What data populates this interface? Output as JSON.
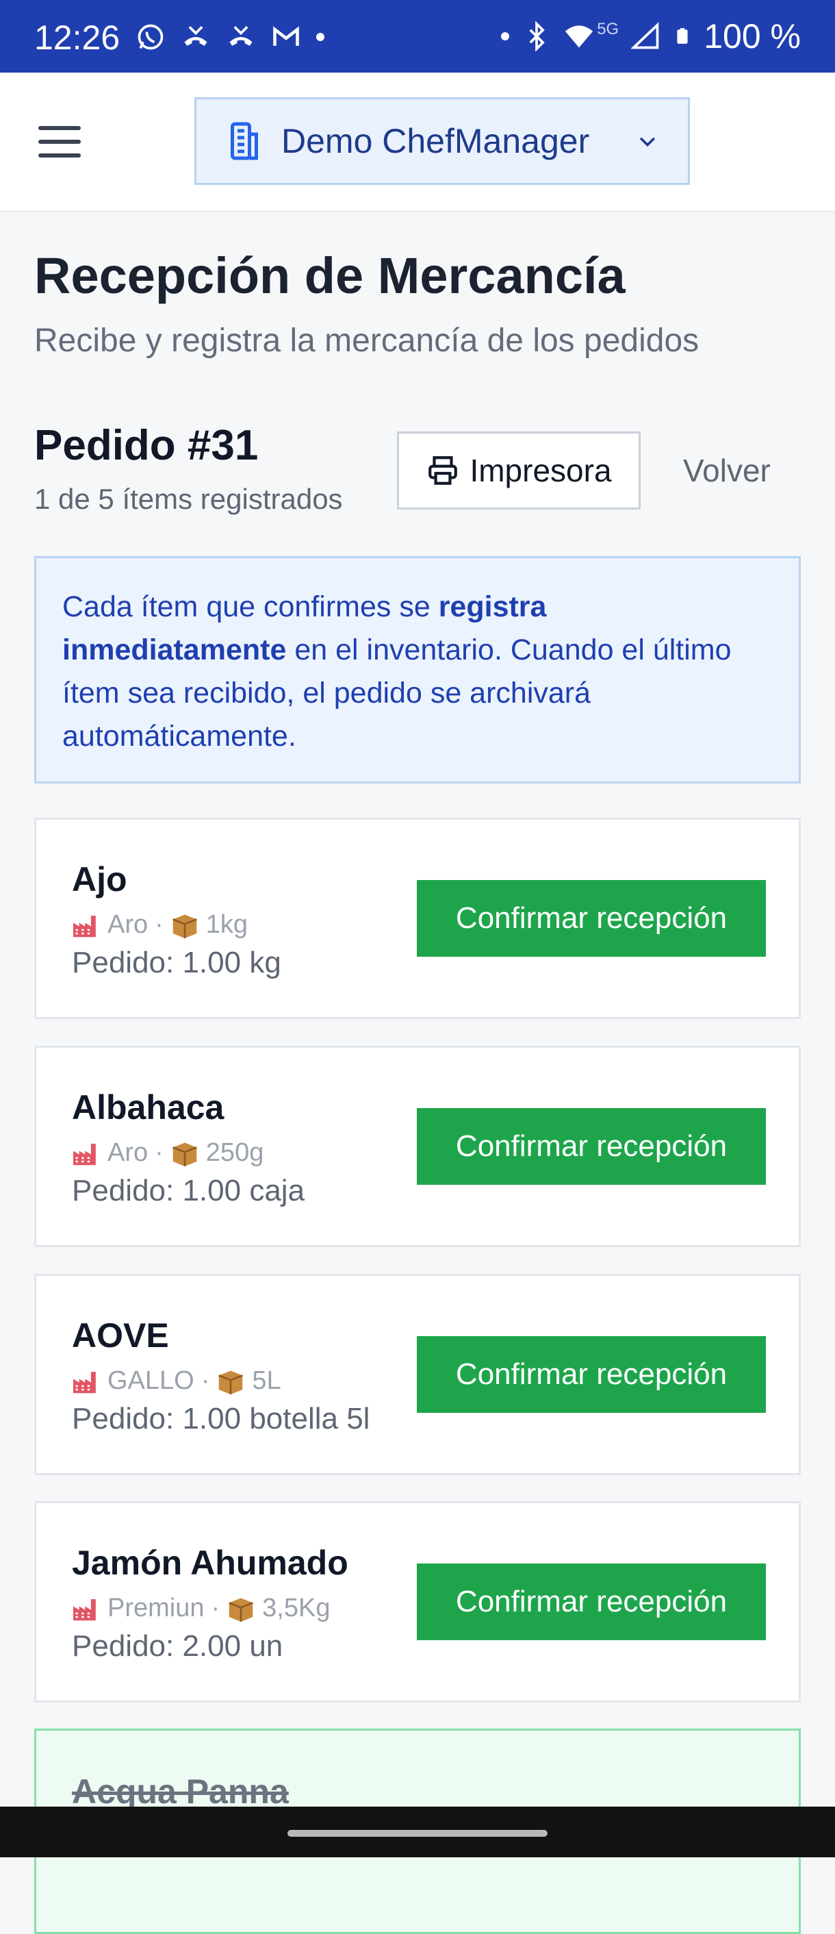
{
  "status_bar": {
    "time": "12:26",
    "battery": "100 %",
    "network": "5G",
    "icons_left": [
      "whatsapp-icon",
      "missed-call-icon",
      "missed-call-icon",
      "gmail-icon",
      "notification-dot"
    ],
    "icons_right": [
      "dot",
      "bluetooth-icon",
      "wifi-icon",
      "signal-icon",
      "battery-icon"
    ]
  },
  "header": {
    "menu_icon": "hamburger-icon",
    "org_name": "Demo ChefManager",
    "org_icon": "building-icon"
  },
  "page": {
    "title": "Recepción de Mercancía",
    "subtitle": "Recibe y registra la mercancía de los pedidos"
  },
  "order": {
    "id_label": "Pedido #31",
    "count_label": "1 de 5 ítems registrados",
    "printer_label": "Impresora",
    "back_label": "Volver"
  },
  "info": {
    "part1": "Cada ítem que confirmes se ",
    "bold": "registra inmediatamente",
    "part2": " en el inventario. Cuando el último ítem sea recibido, el pedido se archivará automáticamente."
  },
  "items": [
    {
      "name": "Ajo",
      "supplier": "Aro",
      "pack": "1kg",
      "ordered": "Pedido: 1.00 kg",
      "action": "Confirmar recepción"
    },
    {
      "name": "Albahaca",
      "supplier": "Aro",
      "pack": "250g",
      "ordered": "Pedido: 1.00 caja",
      "action": "Confirmar recepción"
    },
    {
      "name": "AOVE",
      "supplier": "GALLO",
      "pack": "5L",
      "ordered": "Pedido: 1.00 botella 5l",
      "action": "Confirmar recepción"
    },
    {
      "name": "Jamón Ahumado",
      "supplier": "Premiun",
      "pack": "3,5Kg",
      "ordered": "Pedido: 2.00 un",
      "action": "Confirmar recepción"
    }
  ],
  "received_items": [
    {
      "name": "Acqua Panna"
    }
  ],
  "meta_separator": "·",
  "colors": {
    "status_bar": "#1f3fb0",
    "primary_text": "#1e3a8a",
    "confirm_button": "#1ea54b",
    "info_bg": "#ebf3fe",
    "received_bg": "#eefbf2"
  }
}
